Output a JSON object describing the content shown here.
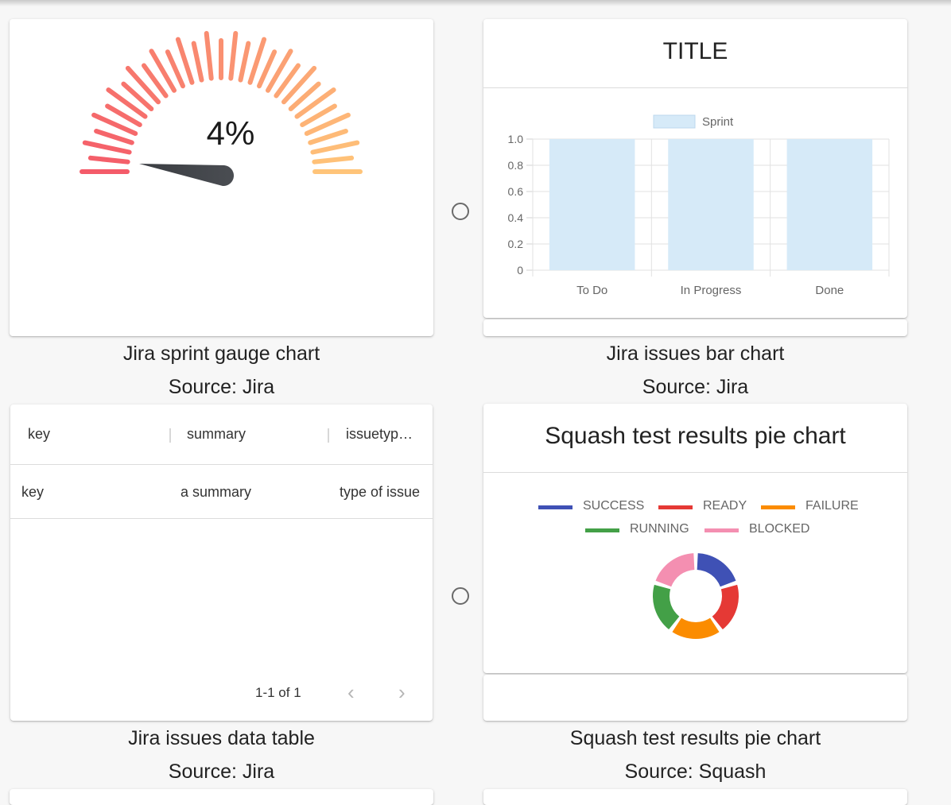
{
  "widgets": [
    {
      "title": "Jira sprint gauge chart",
      "source": "Source: Jira",
      "gauge": {
        "value_label": "4%",
        "value": 0.04
      }
    },
    {
      "title": "Jira issues bar chart",
      "source": "Source: Jira",
      "card_title": "TITLE"
    },
    {
      "title": "Jira issues data table",
      "source": "Source: Jira",
      "table": {
        "columns": [
          "key",
          "summary",
          "issuetyp…"
        ],
        "rows": [
          [
            "key",
            "a summary",
            "type of issue"
          ]
        ],
        "pagination": "1-1 of 1",
        "prev_icon": "chevron-left-icon",
        "next_icon": "chevron-right-icon"
      }
    },
    {
      "title": "Squash test results pie chart",
      "source": "Source: Squash",
      "card_title": "Squash test results pie chart"
    }
  ],
  "chart_data": [
    {
      "type": "bar",
      "categories": [
        "To Do",
        "In Progress",
        "Done"
      ],
      "series": [
        {
          "name": "Sprint",
          "values": [
            1.0,
            1.0,
            1.0
          ],
          "color": "#d6eaf8"
        }
      ],
      "yticks": [
        "1.0",
        "0.8",
        "0.6",
        "0.4",
        "0.2",
        "0"
      ],
      "ylim": [
        0,
        1.0
      ],
      "grid": true,
      "legend": "top"
    },
    {
      "type": "pie",
      "labels": [
        "SUCCESS",
        "READY",
        "FAILURE",
        "RUNNING",
        "BLOCKED"
      ],
      "values": [
        1,
        1,
        1,
        1,
        1
      ],
      "colors": [
        "#3f51b5",
        "#e53935",
        "#fb8c00",
        "#43a047",
        "#f48fb1"
      ],
      "legend": "top"
    }
  ]
}
